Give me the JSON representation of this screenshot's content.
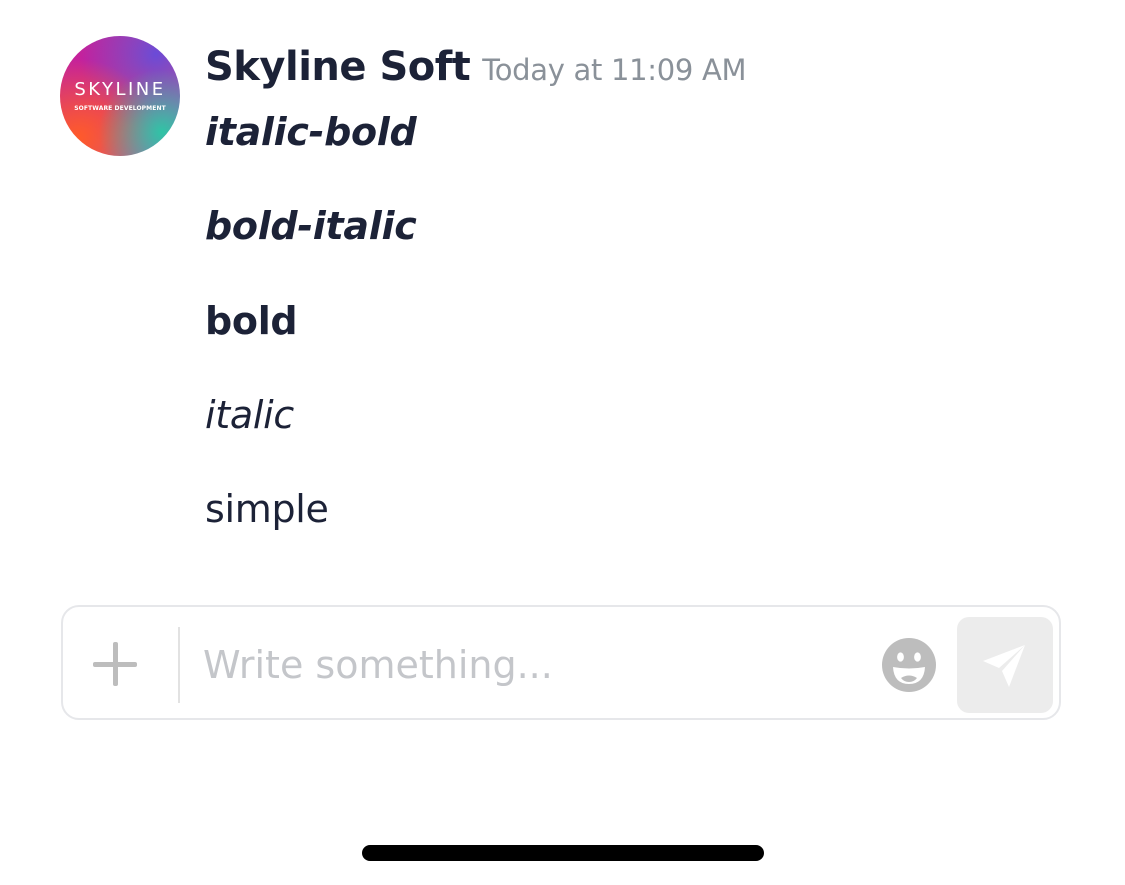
{
  "message": {
    "avatar": {
      "wordmark": "SKYLINE",
      "tagline": "SOFTWARE DEVELOPMENT"
    },
    "sender": "Skyline Soft",
    "timestamp": "Today at 11:09 AM",
    "lines": [
      "italic-bold",
      "bold-italic",
      "bold",
      "italic",
      "simple"
    ]
  },
  "composer": {
    "placeholder": "Write something...",
    "value": ""
  },
  "colors": {
    "text": "#1c2237",
    "muted": "#8a9199",
    "icon_gray": "#bdbdbd",
    "send_bg": "#ececec"
  }
}
